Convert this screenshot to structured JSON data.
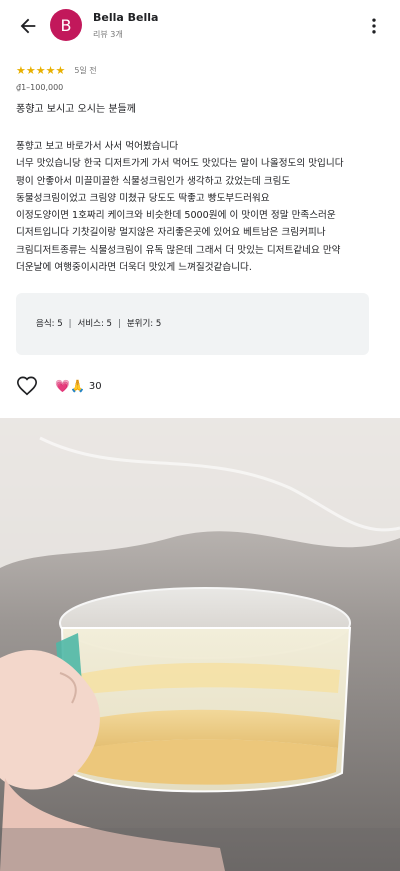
{
  "header": {
    "avatar_initial": "B",
    "reviewer_name": "Bella Bella",
    "reviewer_meta": "리뷰 3개"
  },
  "review": {
    "stars": "★★★★★",
    "rating": 5,
    "date": "5일 전",
    "price": "₫1–100,000",
    "title": "퐁향고 보시고 오시는 분들께",
    "body": "퐁향고 보고 바로가서 사서 먹어봤습니다\n너무 맛있습니당 한국 디저트가게 가서 먹어도 맛있다는 말이 나올정도의 맛입니다\n평이 안좋아서 미끌미끌한 식물성크림인가 생각하고 갔었는데 크림도\n동물성크림이었고 크림양 미쳤규 당도도 딱좋고 빵도부드러워요\n이정도양이면 1호짜리 케이크와 비슷한데 5000원에 이 맛이면 정말 만족스러운\n디저트입니다 기찻길이랑 멀지않은 자리좋은곳에 있어요 베트남은 크림커피나\n크림디저트종류는 식물성크림이 유독 많은데 그래서 더 맛있는 디저트같네요 만약\n더운날에 여행중이시라면 더욱더 맛있게 느껴질것같습니다.",
    "scores": {
      "food": "음식: 5",
      "service": "서비스: 5",
      "atmosphere": "분위기: 5"
    },
    "reactions": {
      "emojis": "💗🙏",
      "count": "30"
    }
  },
  "photo": {
    "description_icon": "cake-photo"
  },
  "colors": {
    "avatar": "#c2185b",
    "star": "#e8b000",
    "panel": "#f1f3f4"
  }
}
